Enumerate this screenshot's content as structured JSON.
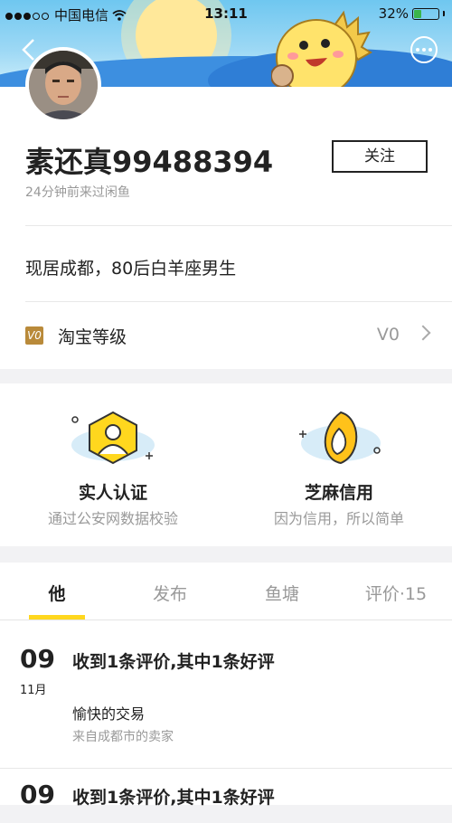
{
  "status_bar": {
    "carrier": "中国电信",
    "time": "13:11",
    "battery": "32%",
    "battery_level": 0.32
  },
  "profile": {
    "name": "素还真99488394",
    "last_seen": "24分钟前来过闲鱼",
    "follow_label": "关注",
    "bio": "现居成都，80后白羊座男生",
    "level_label": "淘宝等级",
    "level_icon_text": "V0",
    "level_value": "V0"
  },
  "verifications": [
    {
      "title": "实人认证",
      "subtitle": "通过公安网数据校验",
      "icon": "person-verify-icon"
    },
    {
      "title": "芝麻信用",
      "subtitle": "因为信用，所以简单",
      "icon": "sesame-credit-icon"
    }
  ],
  "tabs": [
    {
      "label": "他",
      "active": true
    },
    {
      "label": "发布",
      "active": false
    },
    {
      "label": "鱼塘",
      "active": false
    },
    {
      "label": "评价·15",
      "active": false
    }
  ],
  "feed": [
    {
      "day": "09",
      "month": "11月",
      "title": "收到1条评价,其中1条好评",
      "text": "愉快的交易",
      "from": "来自成都市的卖家"
    },
    {
      "day": "09",
      "title": "收到1条评价,其中1条好评"
    }
  ],
  "colors": {
    "accent_yellow": "#ffd71e",
    "level_gold": "#b98a3a",
    "banner_blue": "#3d8fe0"
  }
}
